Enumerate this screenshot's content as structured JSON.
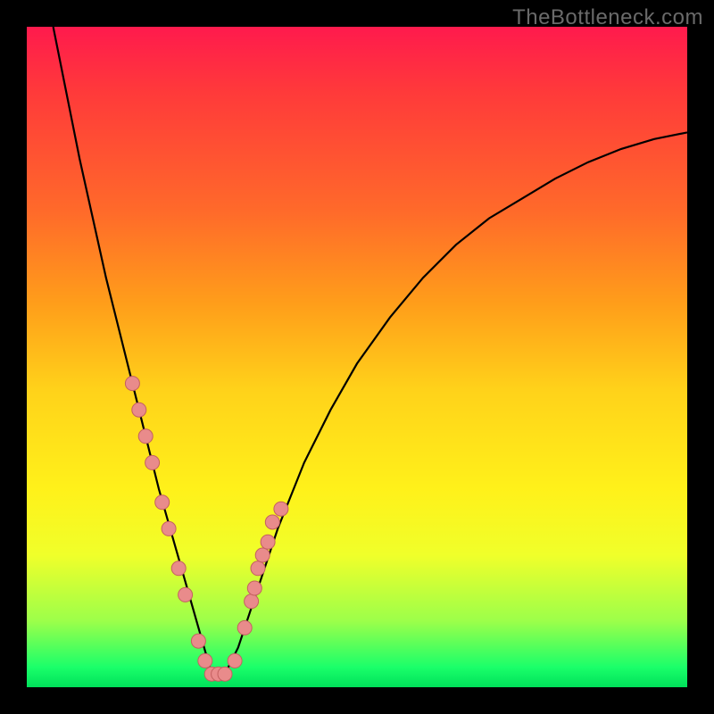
{
  "watermark": "TheBottleneck.com",
  "colors": {
    "frame": "#000000",
    "curve": "#000000",
    "marker_fill": "#e98b8b",
    "marker_stroke": "#c46060",
    "gradient_stops": [
      "#ff1a4d",
      "#ff3a3a",
      "#ff6a2a",
      "#ff9e1a",
      "#ffd21a",
      "#fff11a",
      "#f0ff2a",
      "#9cff4a",
      "#1aff6a",
      "#00e05a"
    ]
  },
  "chart_data": {
    "type": "line",
    "title": "",
    "xlabel": "",
    "ylabel": "",
    "xlim": [
      0,
      100
    ],
    "ylim": [
      0,
      100
    ],
    "x_apex": 28,
    "series": [
      {
        "name": "bottleneck-curve",
        "x": [
          4,
          6,
          8,
          10,
          12,
          14,
          16,
          18,
          20,
          22,
          24,
          26,
          28,
          30,
          32,
          34,
          36,
          38,
          42,
          46,
          50,
          55,
          60,
          65,
          70,
          75,
          80,
          85,
          90,
          95,
          100
        ],
        "y": [
          100,
          90,
          80,
          71,
          62,
          54,
          46,
          38,
          30,
          23,
          16,
          9,
          2,
          2,
          6,
          12,
          18,
          24,
          34,
          42,
          49,
          56,
          62,
          67,
          71,
          74,
          77,
          79.5,
          81.5,
          83,
          84
        ]
      }
    ],
    "markers": {
      "name": "highlighted-points",
      "x": [
        16,
        17,
        18,
        19,
        20.5,
        21.5,
        23,
        24,
        26,
        27,
        28,
        29,
        30,
        31.5,
        33,
        34,
        34.5,
        35,
        35.7,
        36.5,
        37.2,
        38.5
      ],
      "y": [
        46,
        42,
        38,
        34,
        28,
        24,
        18,
        14,
        7,
        4,
        2,
        2,
        2,
        4,
        9,
        13,
        15,
        18,
        20,
        22,
        25,
        27
      ]
    }
  }
}
